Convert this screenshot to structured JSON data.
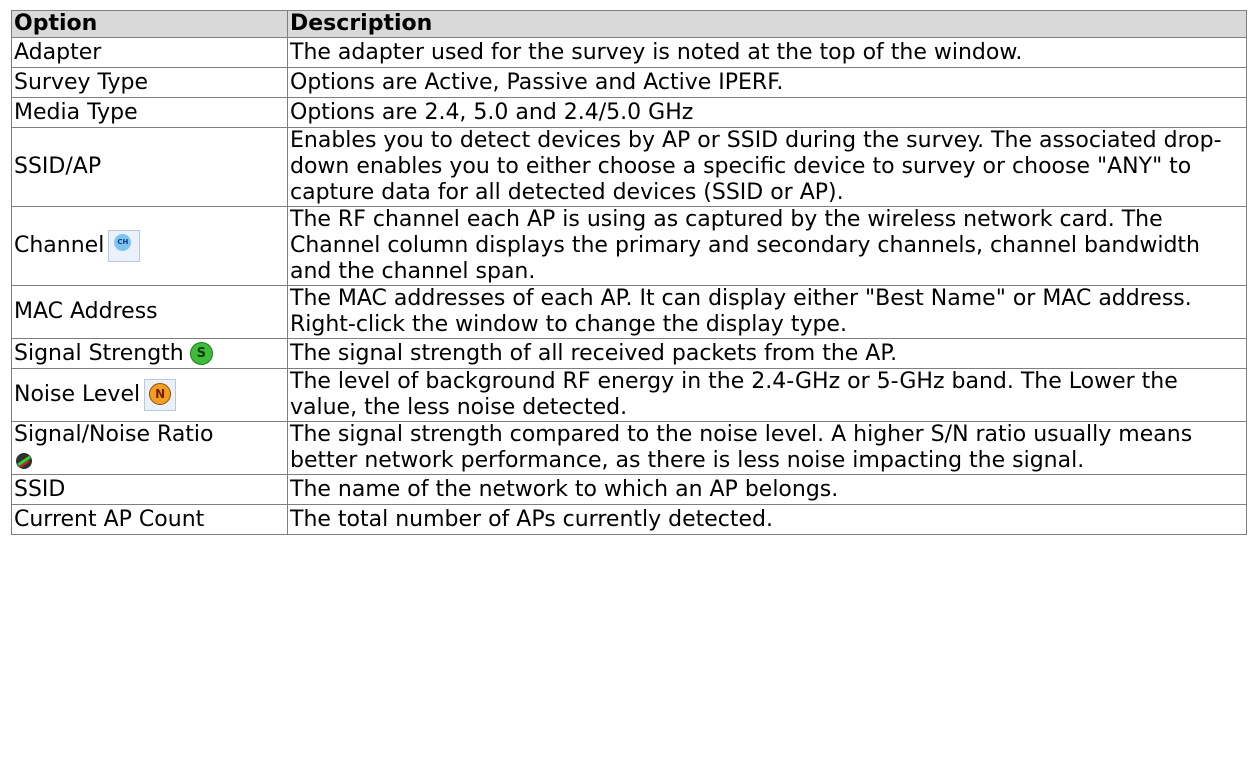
{
  "table": {
    "headers": {
      "option": "Option",
      "description": "Description"
    },
    "rows": [
      {
        "option": "Adapter",
        "description": "The adapter used for the survey is noted at the top of the window."
      },
      {
        "option": "Survey Type",
        "description": "Options are Active, Passive and Active IPERF."
      },
      {
        "option": "Media Type",
        "description": "Options are 2.4, 5.0 and 2.4/5.0 GHz"
      },
      {
        "option": "SSID/AP",
        "description": "Enables you to detect devices by AP or SSID during the survey. The associated drop-down enables you to either choose a specific device to survey or choose \"ANY\" to capture data for all detected devices (SSID or AP)."
      },
      {
        "option": "Channel",
        "icon": "channel-icon",
        "icon_text": "CH",
        "description": "The RF channel each AP is using as captured by the wireless network card. The Channel column displays the primary and secondary channels, channel bandwidth and the channel span."
      },
      {
        "option": "MAC Address",
        "description": "The MAC addresses of each AP. It can display either \"Best Name\" or MAC address. Right-click the window to change the display type."
      },
      {
        "option": "Signal Strength",
        "icon": "signal-strength-icon",
        "icon_text": "S",
        "description": "The signal strength of all received packets from the AP."
      },
      {
        "option": "Noise Level",
        "icon": "noise-level-icon",
        "icon_text": "N",
        "description": "The level of background RF energy in the 2.4-GHz or 5-GHz band. The Lower the value, the less noise detected."
      },
      {
        "option": "Signal/Noise Ratio",
        "icon": "signal-noise-ratio-icon",
        "description": "The signal strength compared to the noise level. A higher S/N ratio usually means better network performance, as there is less noise impacting the signal."
      },
      {
        "option": "SSID",
        "description": "The name of the network to which an AP belongs."
      },
      {
        "option": "Current AP Count",
        "description": "The total number of APs currently detected."
      }
    ]
  }
}
